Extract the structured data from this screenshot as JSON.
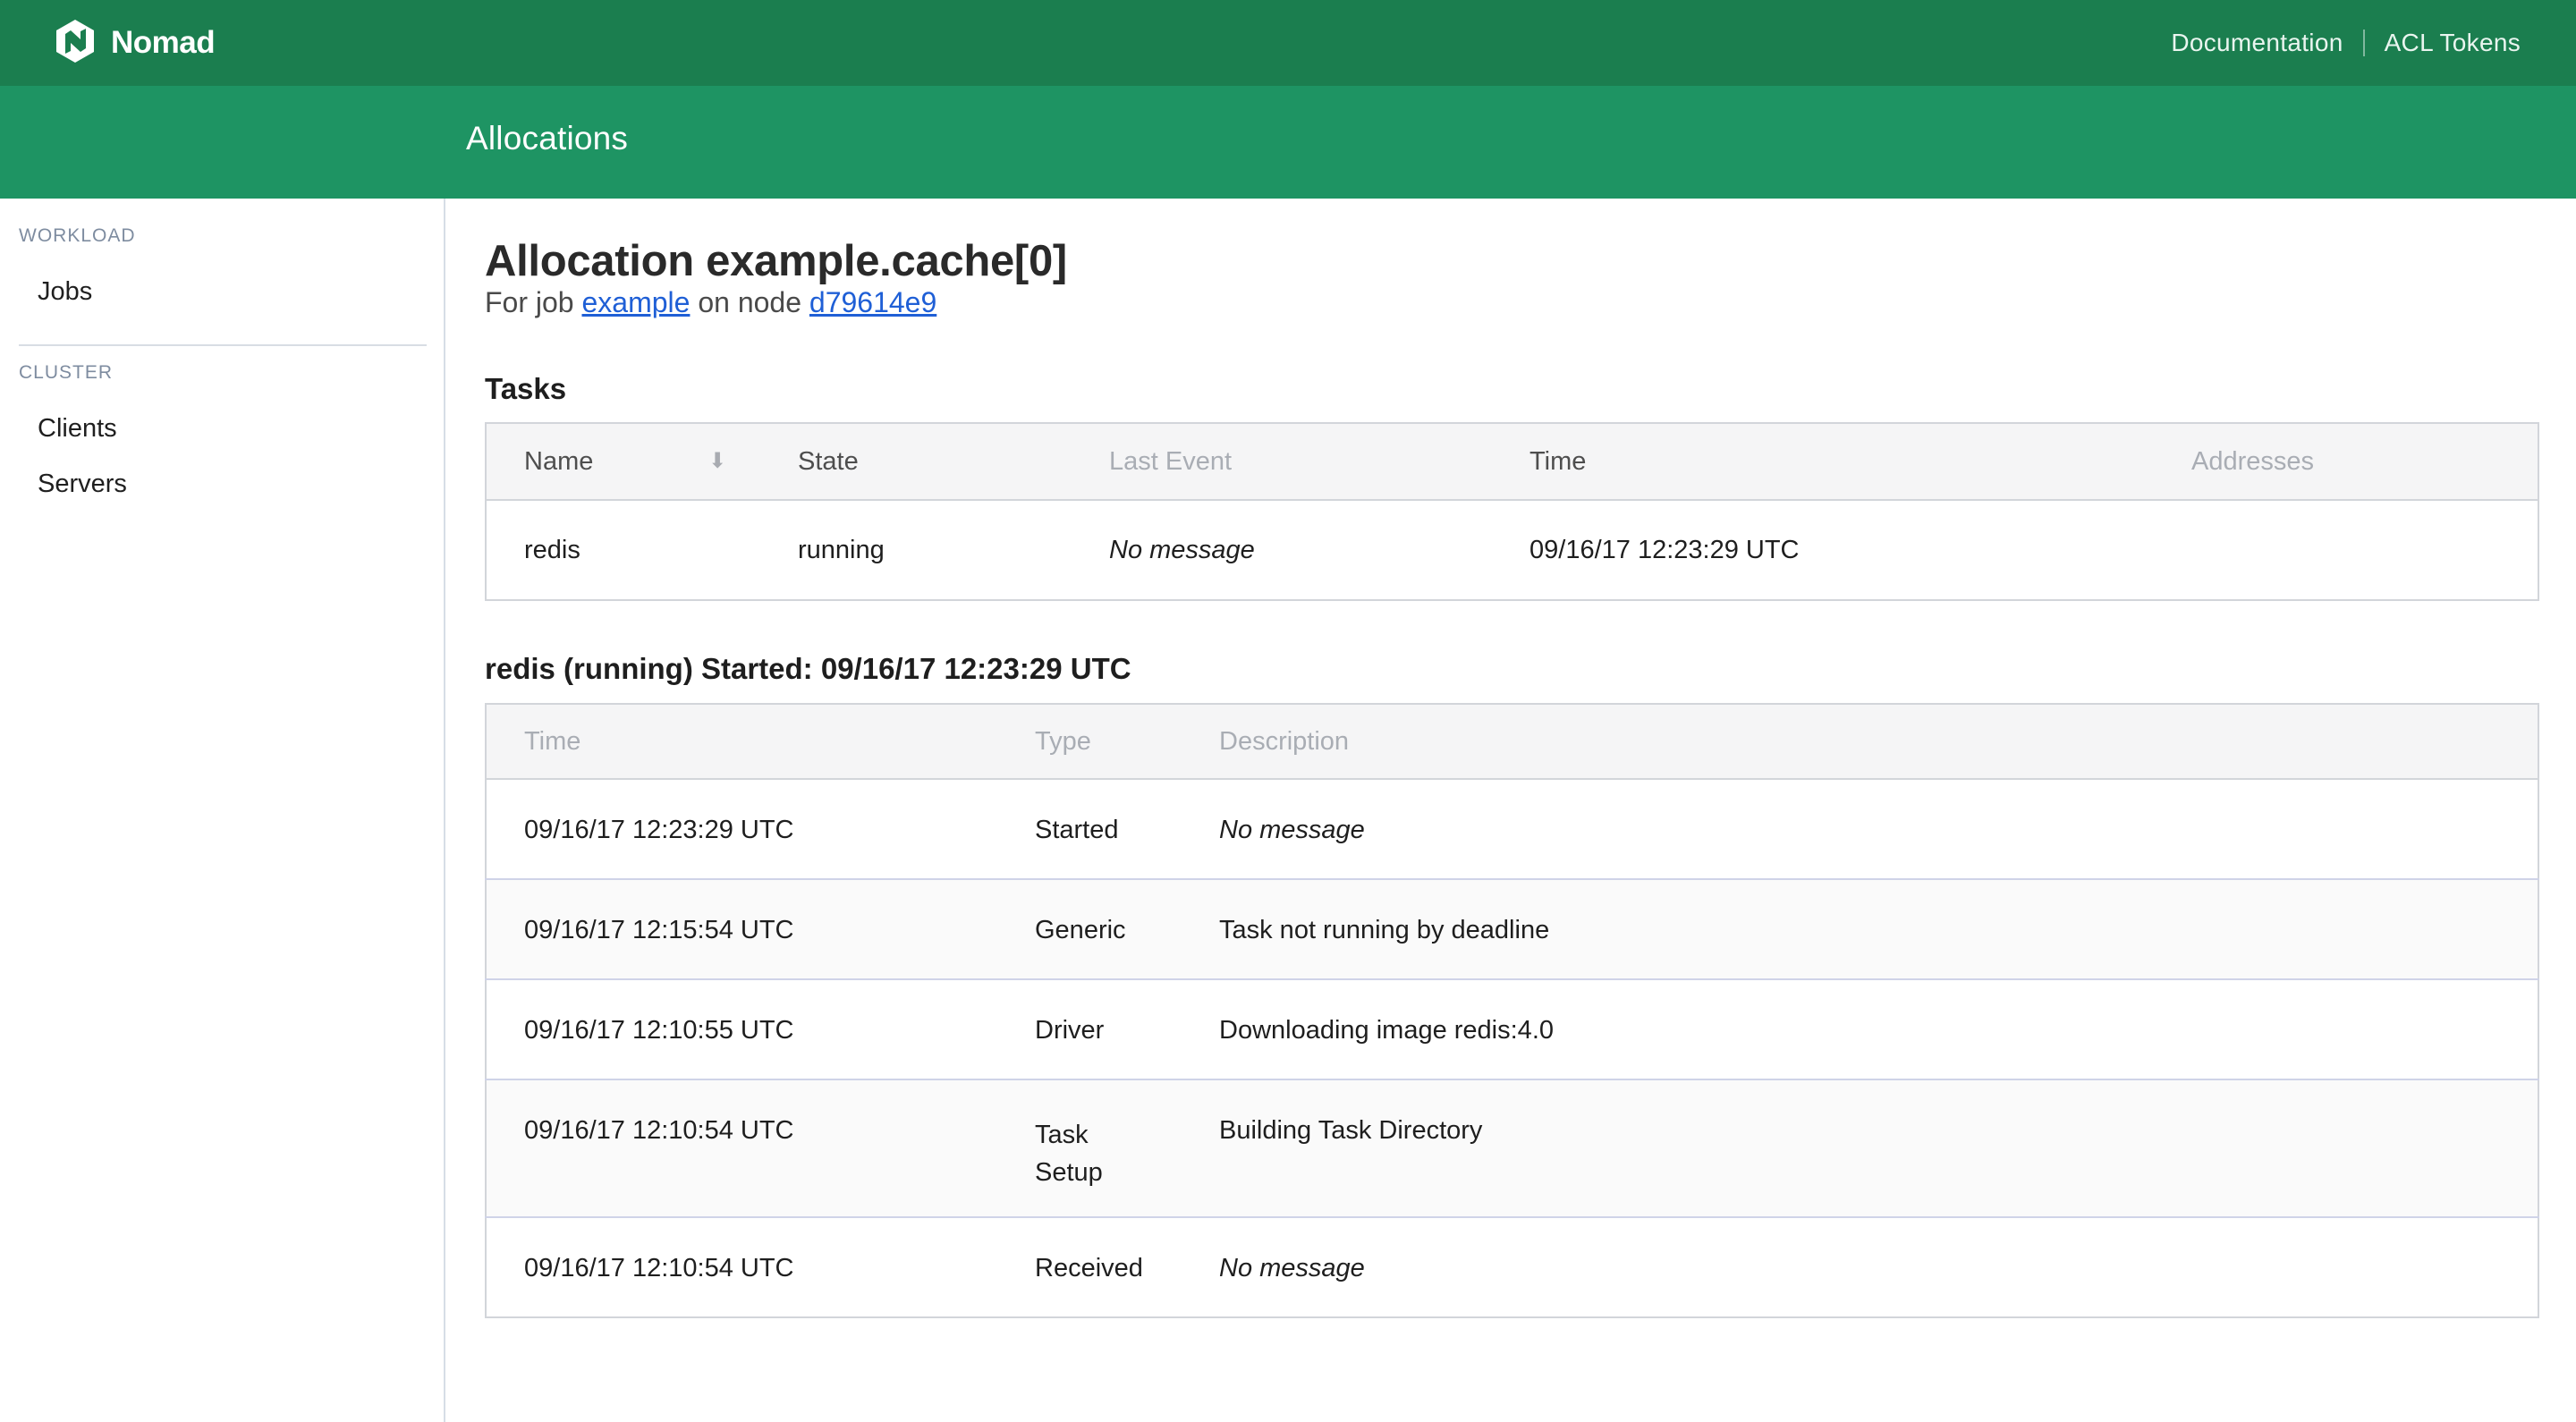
{
  "header": {
    "brand": "Nomad",
    "nav": [
      {
        "label": "Documentation"
      },
      {
        "label": "ACL Tokens"
      }
    ]
  },
  "subnav": {
    "title": "Allocations"
  },
  "sidebar": {
    "sections": [
      {
        "label": "WORKLOAD",
        "items": [
          {
            "label": "Jobs"
          }
        ]
      },
      {
        "label": "CLUSTER",
        "items": [
          {
            "label": "Clients"
          },
          {
            "label": "Servers"
          }
        ]
      }
    ]
  },
  "allocation": {
    "title": "Allocation example.cache[0]",
    "subtitle_prefix": "For job",
    "job_link": "example",
    "subtitle_middle": "on node",
    "node_link": "d79614e9"
  },
  "tasks": {
    "title": "Tasks",
    "columns": [
      "Name",
      "State",
      "Last Event",
      "Time",
      "Addresses"
    ],
    "sort_icon": "arrow-down-icon",
    "rows": [
      {
        "name": "redis",
        "state": "running",
        "last_event": "No message",
        "time": "09/16/17 12:23:29 UTC",
        "addresses": ""
      }
    ]
  },
  "events": {
    "title": "redis (running) Started: 09/16/17 12:23:29 UTC",
    "columns": [
      "Time",
      "Type",
      "Description"
    ],
    "rows": [
      {
        "time": "09/16/17 12:23:29 UTC",
        "type_line1": "Started",
        "type_line2": "",
        "description": "No message",
        "italic": true
      },
      {
        "time": "09/16/17 12:15:54 UTC",
        "type_line1": "Generic",
        "type_line2": "",
        "description": "Task not running by deadline",
        "italic": false
      },
      {
        "time": "09/16/17 12:10:55 UTC",
        "type_line1": "Driver",
        "type_line2": "",
        "description": "Downloading image redis:4.0",
        "italic": false
      },
      {
        "time": "09/16/17 12:10:54 UTC",
        "type_line1": "Task",
        "type_line2": "Setup",
        "description": "Building Task Directory",
        "italic": false
      },
      {
        "time": "09/16/17 12:10:54 UTC",
        "type_line1": "Received",
        "type_line2": "",
        "description": "No message",
        "italic": true
      }
    ]
  },
  "colors": {
    "topbar": "#1b7e4f",
    "subbar": "#1e9463",
    "link": "#1f5fd6"
  }
}
